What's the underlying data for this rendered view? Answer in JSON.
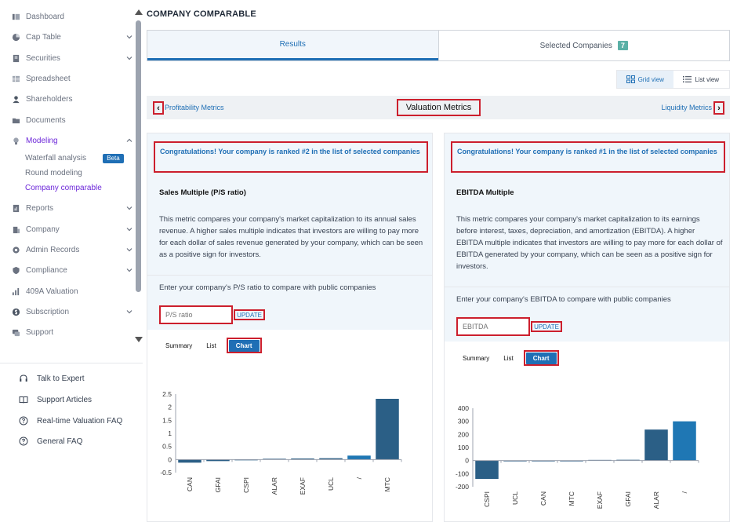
{
  "sidebar": {
    "items": [
      {
        "label": "Dashboard",
        "icon": "dashboard-icon",
        "expandable": false
      },
      {
        "label": "Cap Table",
        "icon": "pie-chart-icon",
        "expandable": true
      },
      {
        "label": "Securities",
        "icon": "document-icon",
        "expandable": true
      },
      {
        "label": "Spreadsheet",
        "icon": "spreadsheet-icon",
        "expandable": false
      },
      {
        "label": "Shareholders",
        "icon": "user-icon",
        "expandable": false
      },
      {
        "label": "Documents",
        "icon": "folder-icon",
        "expandable": false
      },
      {
        "label": "Modeling",
        "icon": "lightbulb-icon",
        "expandable": true
      },
      {
        "label": "Reports",
        "icon": "report-icon",
        "expandable": true
      },
      {
        "label": "Company",
        "icon": "building-icon",
        "expandable": true
      },
      {
        "label": "Admin Records",
        "icon": "gear-icon",
        "expandable": true
      },
      {
        "label": "Compliance",
        "icon": "shield-icon",
        "expandable": true
      },
      {
        "label": "409A Valuation",
        "icon": "chart-icon",
        "expandable": false
      },
      {
        "label": "Subscription",
        "icon": "dollar-icon",
        "expandable": true
      },
      {
        "label": "Support",
        "icon": "support-icon",
        "expandable": false
      }
    ],
    "modeling_sub": [
      {
        "label": "Waterfall analysis"
      },
      {
        "label": "Round modeling"
      },
      {
        "label": "Company comparable"
      }
    ],
    "beta_label": "Beta",
    "help_items": [
      {
        "label": "Talk to Expert",
        "icon": "headset-icon"
      },
      {
        "label": "Support Articles",
        "icon": "book-icon"
      },
      {
        "label": "Real-time Valuation FAQ",
        "icon": "question-circle-icon"
      },
      {
        "label": "General FAQ",
        "icon": "question-circle-icon"
      }
    ]
  },
  "page": {
    "title": "COMPANY COMPARABLE",
    "tabs": [
      {
        "label": "Results"
      },
      {
        "label": "Selected Companies",
        "count": "7"
      }
    ],
    "view_toggle": {
      "grid": "Grid view",
      "list": "List view"
    },
    "metrics_nav": {
      "prev": "Profitability Metrics",
      "current": "Valuation Metrics",
      "next": "Liquidity Metrics"
    }
  },
  "cards": [
    {
      "rank_message": "Congratulations! Your company is ranked #2 in the list of selected companies",
      "metric_name": "Sales Multiple (P/S ratio)",
      "description": "This metric compares your company's market capitalization to its annual sales revenue. A higher sales multiple indicates that investors are willing to pay more for each dollar of sales revenue generated by your company, which can be seen as a positive sign for investors.",
      "enter_label": "Enter your company's P/S ratio to compare with public companies",
      "input_placeholder": "P/S ratio",
      "update_label": "UPDATE",
      "view_tabs": [
        "Summary",
        "List",
        "Chart"
      ]
    },
    {
      "rank_message": "Congratulations! Your company is ranked #1 in the list of selected companies",
      "metric_name": "EBITDA Multiple",
      "description": "This metric compares your company's market capitalization to its earnings before interest, taxes, depreciation, and amortization (EBITDA). A higher EBITDA multiple indicates that investors are willing to pay more for each dollar of EBITDA generated by your company, which can be seen as a positive sign for investors.",
      "enter_label": "Enter your company's EBITDA to compare with public companies",
      "input_placeholder": "EBITDA",
      "update_label": "UPDATE",
      "view_tabs": [
        "Summary",
        "List",
        "Chart"
      ]
    }
  ],
  "chart_data": [
    {
      "type": "bar",
      "categories": [
        "CAN",
        "GFAI",
        "CSPI",
        "ALAR",
        "AEXAF",
        "UCL",
        "/",
        "MTC"
      ],
      "values": [
        -0.12,
        -0.06,
        -0.01,
        0.03,
        0.04,
        0.05,
        0.15,
        2.32
      ],
      "ylim": [
        -0.5,
        2.5
      ],
      "yticks": [
        "2.5",
        "2",
        "1.5",
        "1",
        "0.5",
        "0",
        "-0.5"
      ],
      "ytick_values": [
        2.5,
        2,
        1.5,
        1,
        0.5,
        0,
        -0.5
      ],
      "grid": false,
      "colors": {
        "default": "#2b5f86",
        "highlight": "#1f77b4"
      },
      "highlight_category": "/"
    },
    {
      "type": "bar",
      "categories": [
        "CSPI",
        "UCL",
        "CAN",
        "MTC",
        "AEXAF",
        "GFAI",
        "ALAR",
        "/"
      ],
      "values": [
        -140,
        -4,
        -3,
        -3,
        5,
        6,
        237,
        300
      ],
      "ylim": [
        -200,
        400
      ],
      "yticks": [
        "400",
        "300",
        "200",
        "100",
        "0",
        "-100",
        "-200"
      ],
      "ytick_values": [
        400,
        300,
        200,
        100,
        0,
        -100,
        -200
      ],
      "grid": false,
      "colors": {
        "default": "#2b5f86",
        "highlight": "#1f77b4"
      },
      "highlight_category": "/"
    }
  ],
  "colors": {
    "accent": "#1f6fb5",
    "active_nav": "#6d28d9",
    "highlight_border": "#cc1f2d",
    "badge": "#5ab0a6"
  }
}
